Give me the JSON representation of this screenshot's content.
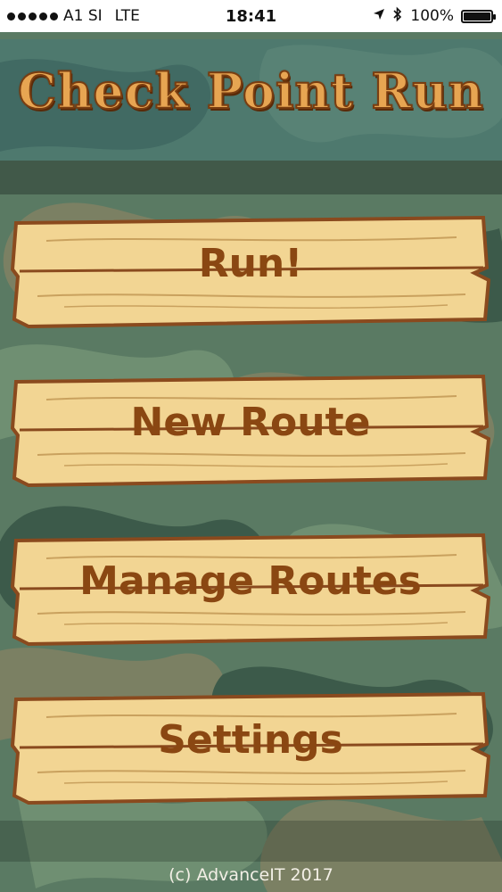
{
  "status_bar": {
    "carrier": "A1 SI",
    "network": "LTE",
    "time": "18:41",
    "battery_percent": "100%",
    "battery_level": 1.0,
    "icons": [
      "signal-dots-icon",
      "location-arrow-icon",
      "bluetooth-icon",
      "battery-icon"
    ]
  },
  "app": {
    "title": "Check Point Run"
  },
  "menu": {
    "run_label": "Run!",
    "new_route_label": "New Route",
    "manage_routes_label": "Manage Routes",
    "settings_label": "Settings"
  },
  "footer": {
    "copyright": "(c) AdvanceIT 2017"
  },
  "colors": {
    "title_fill": "#e7a552",
    "title_outline": "#7a3d10",
    "plank_wood": "#f2d593",
    "plank_edge": "#8a4a1e",
    "label_text": "#8a4712",
    "camo_dark": "#3c5a4a",
    "camo_mid": "#5a7a63",
    "camo_light": "#6f8f72",
    "camo_tan": "#7b8063"
  }
}
